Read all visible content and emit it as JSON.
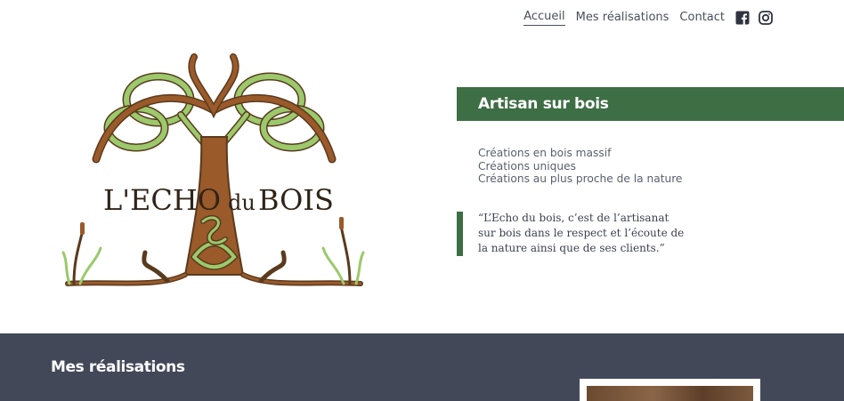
{
  "nav": {
    "items": [
      {
        "label": "Accueil",
        "active": true
      },
      {
        "label": "Mes réalisations",
        "active": false
      },
      {
        "label": "Contact",
        "active": false
      }
    ],
    "social": [
      "facebook-icon",
      "instagram-icon"
    ]
  },
  "logo": {
    "text_main": "L'ECHO",
    "text_du": "du",
    "text_bois": "BOIS"
  },
  "hero": {
    "title": "Artisan sur bois",
    "features": [
      "Créations en bois massif",
      "Créations uniques",
      "Créations au plus proche de la nature"
    ],
    "quote": "“L’Echo du bois, c’est de l’artisanat sur bois dans le respect et l’écoute de la nature ainsi que de ses clients.”"
  },
  "gallery": {
    "title": "Mes réalisations"
  },
  "colors": {
    "accent_green": "#3d6e44",
    "leaf_green": "#8fc162",
    "trunk_brown": "#9a5a2a",
    "footer_band": "#434859"
  }
}
